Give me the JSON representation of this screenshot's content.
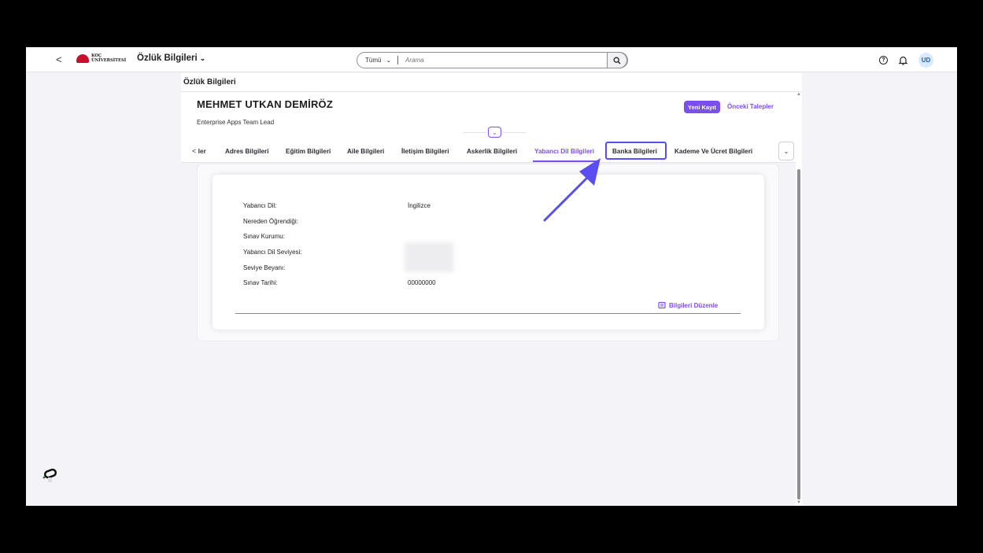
{
  "shellbar": {
    "back": "<",
    "logo_line1": "KOÇ",
    "logo_line2": "ÜNİVERSİTESİ",
    "app_title": "Özlük Bilgileri",
    "app_title_chevron": "⌄",
    "search_scope": "Tümü",
    "search_scope_chevron": "⌄",
    "search_placeholder": "Arama",
    "help": "?",
    "bell": "🔔",
    "avatar": "UD"
  },
  "page": {
    "title": "Özlük Bilgileri"
  },
  "header": {
    "name": "MEHMET UTKAN DEMİRÖZ",
    "role": "Enterprise Apps Team Lead",
    "new_record": "Yeni Kayıt",
    "previous_requests": "Önceki Talepler",
    "collapse": "⌄"
  },
  "tabs": {
    "prev": "<",
    "truncated": "ler",
    "items": [
      "Adres Bilgileri",
      "Eğitim Bilgileri",
      "Aile Bilgileri",
      "İletişim Bilgileri",
      "Askerlik Bilgileri",
      "Yabancı Dil Bilgileri",
      "Banka Bilgileri",
      "Kademe Ve Ücret Bilgileri"
    ],
    "active": "Yabancı Dil Bilgileri",
    "highlighted": "Banka Bilgileri",
    "overflow": "⌄"
  },
  "form": {
    "fields": [
      {
        "label": "Yabancı Dil:",
        "value": "İngilizce"
      },
      {
        "label": "Nereden Öğrendiği:",
        "value": ""
      },
      {
        "label": "Sınav Kurumu:",
        "value": ""
      },
      {
        "label": "Yabancı Dil Seviyesi:",
        "value": ""
      },
      {
        "label": "Seviye Beyanı:",
        "value": ""
      },
      {
        "label": "Sınav Tarihi:",
        "value": "00000000"
      }
    ],
    "edit_label": "Bilgileri Düzenle"
  },
  "colors": {
    "accent": "#7b4ef0",
    "highlight": "#5a4ef0"
  }
}
